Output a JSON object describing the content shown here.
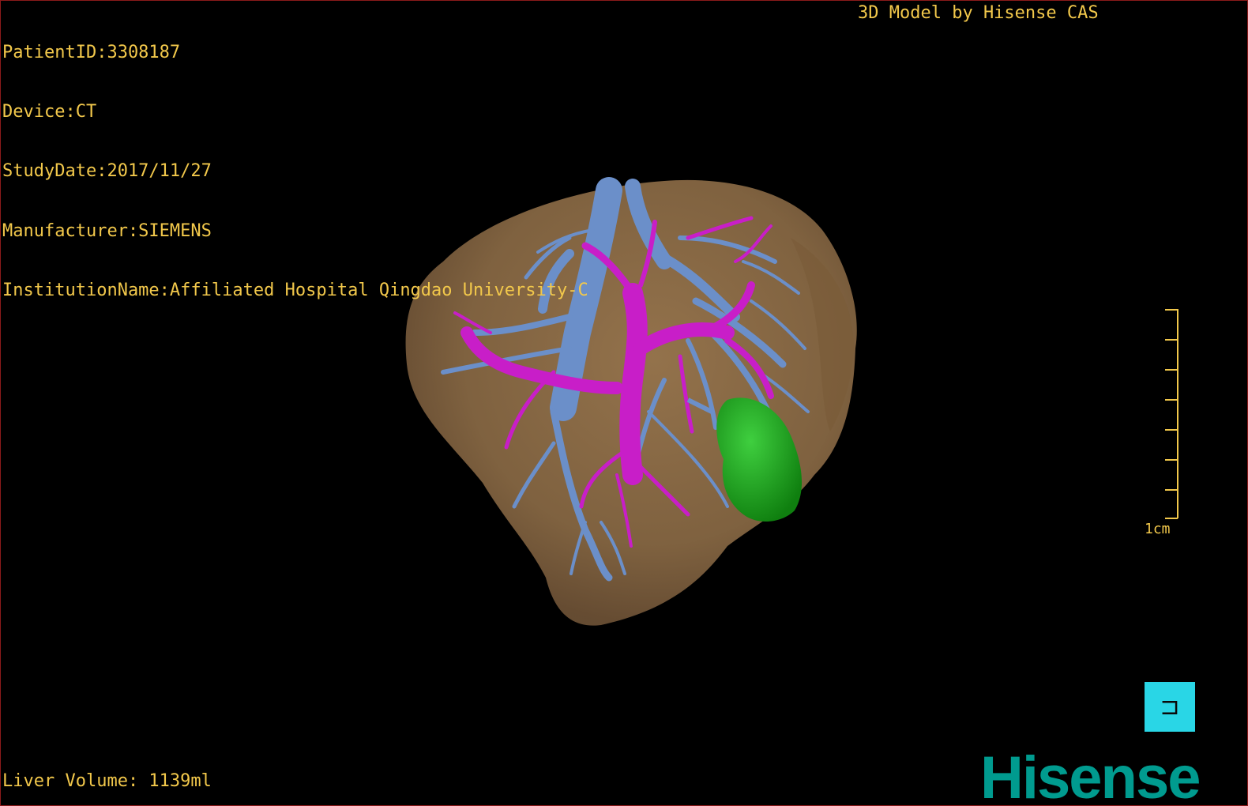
{
  "overlay": {
    "patient_id": "PatientID:3308187",
    "device": "Device:CT",
    "study_date": "StudyDate:2017/11/27",
    "manufacturer": "Manufacturer:SIEMENS",
    "institution": "InstitutionName:Affiliated Hospital Qingdao University-C",
    "watermark": "3D Model by Hisense CAS",
    "liver_volume": "Liver Volume: 1139ml"
  },
  "scale": {
    "label": "1cm"
  },
  "orientation": {
    "glyph": "⊐",
    "icon": "orientation-cube-icon"
  },
  "logo": {
    "text": "Hisense"
  },
  "colors": {
    "overlay_text": "#f2c84b",
    "liver": "#8c6a44",
    "hepatic_vein": "#6b8fc9",
    "portal_vein": "#c81ec8",
    "lesion": "#1aa51a",
    "orientation_box": "#29d6e6",
    "logo": "#009b8f"
  }
}
